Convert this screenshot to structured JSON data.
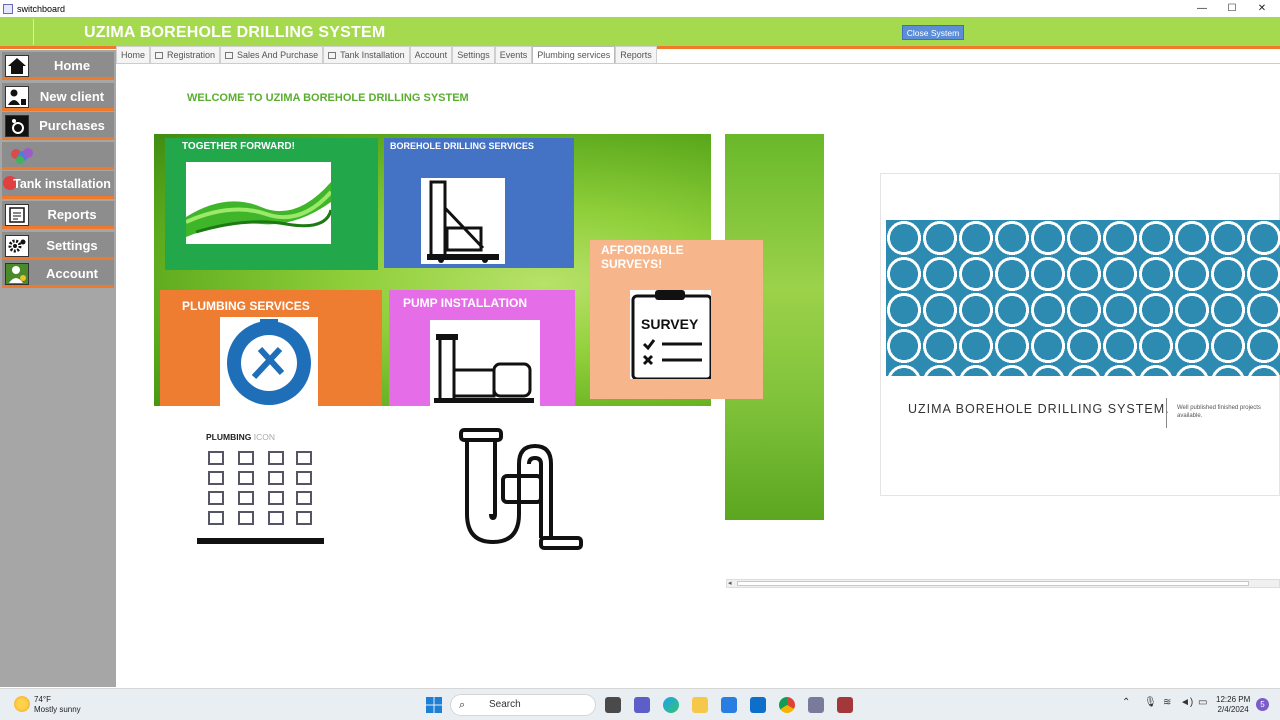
{
  "window": {
    "title": "switchboard",
    "minimize": "—",
    "maximize": "☐",
    "close": "✕"
  },
  "header": {
    "title": "UZIMA BOREHOLE DRILLING SYSTEM",
    "close_button": "Close System"
  },
  "sidebar": {
    "items": [
      {
        "label": "Home",
        "icon": "house-icon"
      },
      {
        "label": "New client",
        "icon": "person-icon"
      },
      {
        "label": "Purchases",
        "icon": "cart-icon"
      },
      {
        "label": "",
        "icon": "coins-icon"
      },
      {
        "label": "Tank installation",
        "icon": "tank-icon"
      },
      {
        "label": "Reports",
        "icon": "report-icon"
      },
      {
        "label": "Settings",
        "icon": "gear-icon"
      },
      {
        "label": "Account",
        "icon": "account-icon"
      }
    ]
  },
  "tabs": [
    {
      "label": "Home",
      "checkbox": false
    },
    {
      "label": "Registration",
      "checkbox": true
    },
    {
      "label": "Sales And Purchase",
      "checkbox": true
    },
    {
      "label": "Tank Installation",
      "checkbox": true
    },
    {
      "label": "Account",
      "checkbox": false
    },
    {
      "label": "Settings",
      "checkbox": false
    },
    {
      "label": "Events",
      "checkbox": false
    },
    {
      "label": "Plumbing services",
      "checkbox": false,
      "active": true
    },
    {
      "label": "Reports",
      "checkbox": false
    }
  ],
  "main": {
    "welcome": "WELCOME TO UZIMA BOREHOLE DRILLING SYSTEM",
    "tiles": {
      "together": "TOGETHER FORWARD!",
      "borehole": "BOREHOLE DRILLING SERVICES",
      "plumbing": "PLUMBING SERVICES",
      "pump": "PUMP INSTALLATION",
      "surveys": "AFFORDABLE SURVEYS!",
      "survey_word": "SURVEY",
      "plumbing_logo_text": "PLUMBING SERVICES"
    },
    "plumbing_icon": {
      "title_bold": "PLUMBING",
      "title_light": "ICON"
    },
    "slide": {
      "title": "UZIMA BOREHOLE DRILLING SYSTEM.",
      "subtitle": "Well published finished projects available."
    }
  },
  "colors": {
    "header": "#a5d94e",
    "accent": "#f07a2c",
    "sidebar": "#a6a6a6",
    "tile_green": "#22a84a",
    "tile_blue": "#4472c4",
    "tile_orange": "#ee7d31",
    "tile_pink": "#e56ee8",
    "tile_peach": "#f6b58a"
  },
  "taskbar": {
    "weather_temp": "74°F",
    "weather_desc": "Mostly sunny",
    "search": "Search",
    "time": "12:26 PM",
    "date": "2/4/2024",
    "notifications": "5"
  }
}
